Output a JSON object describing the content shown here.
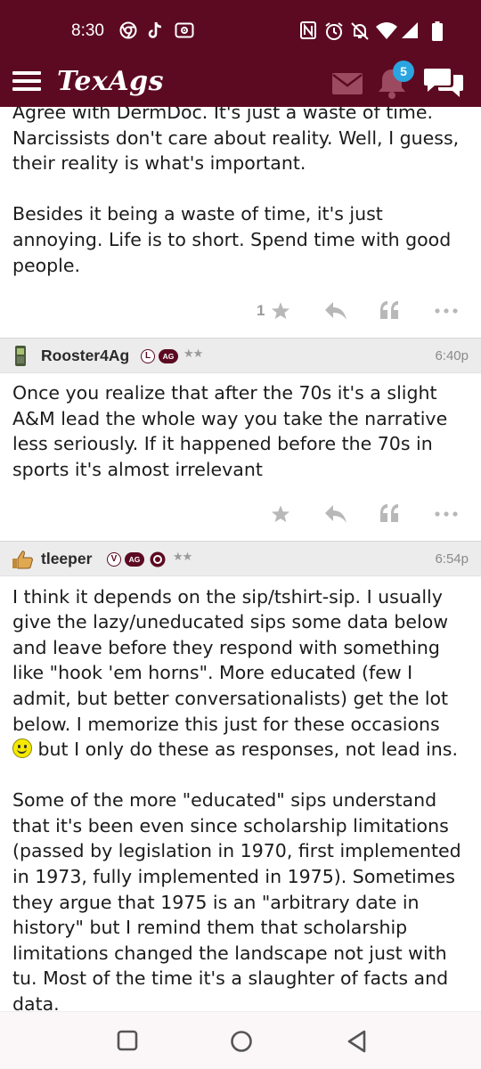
{
  "status_bar": {
    "time": "8:30",
    "left_icons": [
      "chrome-icon",
      "tiktok-icon",
      "cast-icon"
    ],
    "right_icons": [
      "nfc-icon",
      "alarm-icon",
      "mute-icon",
      "wifi-icon",
      "signal-icon",
      "battery-icon"
    ]
  },
  "app_bar": {
    "logo": "TexAgs",
    "notification_count": "5",
    "icons": [
      "menu-icon",
      "mail-icon",
      "bell-icon",
      "chat-icon"
    ],
    "colors": {
      "brand": "#5c0a22",
      "badge": "#2aa5e0"
    }
  },
  "posts": [
    {
      "paragraphs": [
        "Agree with DermDoc. It's just a waste of time.\nNarcissists don't care about reality. Well, I guess,\ntheir reality is what's important.",
        "Besides it being a waste of time, it's just\nannoying. Life is to short. Spend time with good\npeople."
      ],
      "star_count": "1"
    },
    {
      "author": "Rooster4Ag",
      "badges": [
        "L",
        "AG"
      ],
      "stars": "★★",
      "time": "6:40p",
      "paragraphs": [
        "Once you realize that after the 70s it's a slight\nA&M lead the whole way you take the narrative\nless seriously. If it happened before the 70s in\nsports it's almost irrelevant"
      ]
    },
    {
      "author": "tleeper",
      "badges": [
        "V",
        "AG"
      ],
      "stars": "★★",
      "time": "6:54p",
      "paragraph1_text": "I think it depends on the sip/tshirt-sip. I usually\ngive the lazy/uneducated sips some data below\nand leave before they respond with something\nlike \"hook 'em horns\". More educated (few I\nadmit, but better conversationalists) get the lot\nbelow. I memorize this just for these occasions\n",
      "paragraph1_tail": " but I only do these as responses, not lead ins.",
      "paragraph2": "Some of the more \"educated\" sips understand\nthat it's been even since scholarship limitations\n(passed by legislation in 1970, first implemented\nin 1973, fully implemented in 1975). Sometimes\nthey argue that 1975 is an \"arbitrary date in\nhistory\" but I remind them that scholarship\nlimitations changed the landscape not just with\ntu. Most of the time it's a slaughter of facts and\ndata."
    }
  ],
  "nav_bar": {
    "buttons": [
      "recents-button",
      "home-button",
      "back-button"
    ]
  }
}
